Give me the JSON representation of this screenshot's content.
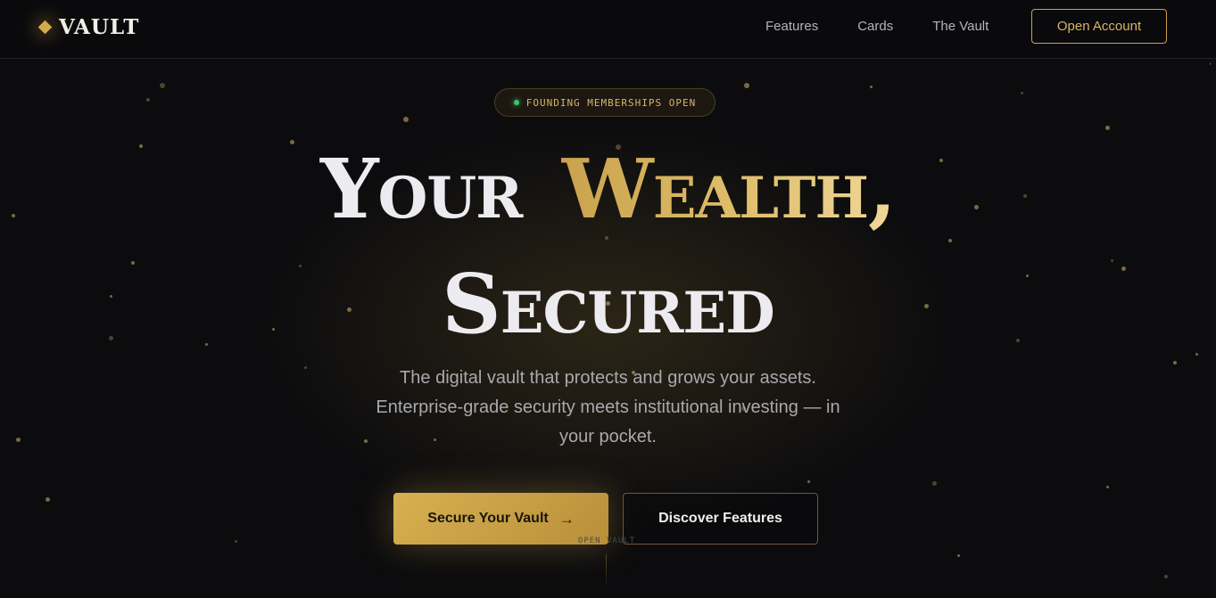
{
  "brand": {
    "name": "VAULT",
    "accent": "#d4a94a"
  },
  "nav": {
    "links": [
      "Features",
      "Cards",
      "The Vault"
    ],
    "cta": "Open Account"
  },
  "hero": {
    "badge": "FOUNDING MEMBERSHIPS OPEN",
    "headline": {
      "word1": "Your",
      "word2": "Wealth,",
      "word3": "Secured"
    },
    "subtitle": "The digital vault that protects and grows your assets. Enterprise-grade security meets institutional investing — in your pocket.",
    "primary_cta": "Secure Your Vault",
    "secondary_cta": "Discover Features",
    "scroll_hint": "OPEN VAULT"
  }
}
